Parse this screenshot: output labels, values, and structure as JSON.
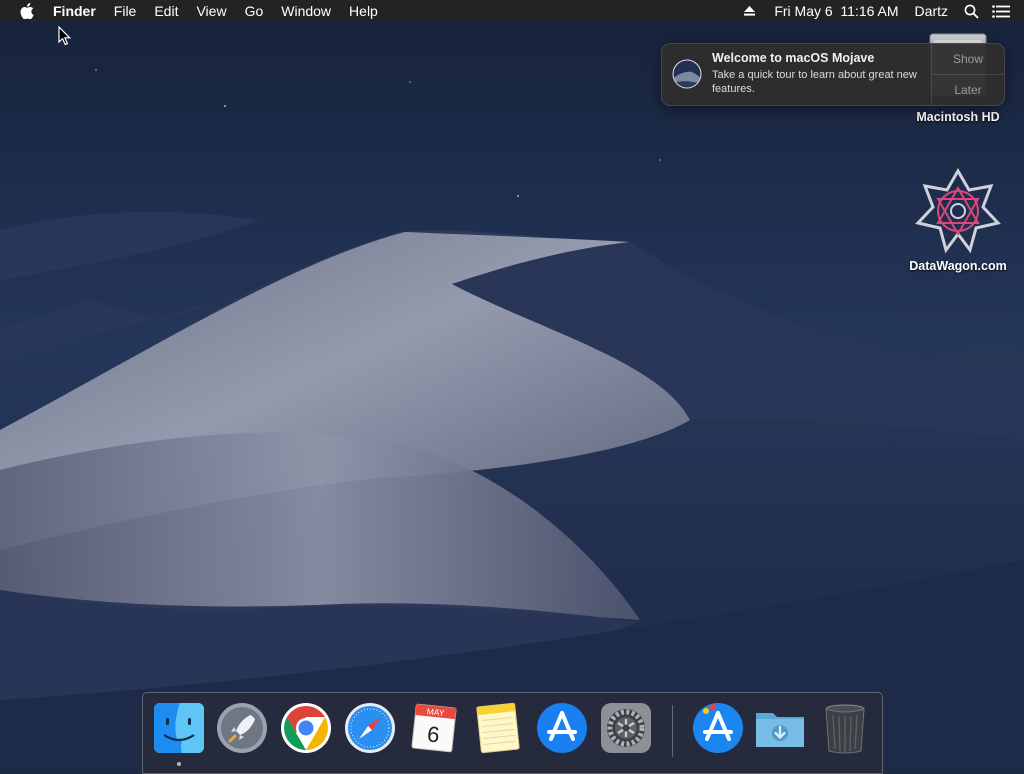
{
  "menubar": {
    "apple_icon": "apple-icon",
    "app_name": "Finder",
    "menus": [
      "File",
      "Edit",
      "View",
      "Go",
      "Window",
      "Help"
    ],
    "date_time": "Fri May 6  11:16 AM",
    "user": "Dartz",
    "icons": [
      "eject-icon",
      "spotlight-search-icon",
      "notification-center-icon"
    ]
  },
  "notification": {
    "title": "Welcome to macOS Mojave",
    "body": "Take a quick tour to learn about great new features.",
    "show_label": "Show",
    "later_label": "Later"
  },
  "desktop": {
    "items": [
      {
        "label": "Macintosh HD",
        "icon": "hard-drive-icon"
      },
      {
        "label": "DataWagon.com",
        "icon": "datawagon-logo-icon"
      }
    ]
  },
  "dock": {
    "apps": [
      {
        "name": "Finder",
        "icon": "finder-icon",
        "running": true
      },
      {
        "name": "Launchpad",
        "icon": "launchpad-icon"
      },
      {
        "name": "Google Chrome",
        "icon": "chrome-icon"
      },
      {
        "name": "Safari",
        "icon": "safari-icon"
      },
      {
        "name": "Calendar",
        "icon": "calendar-icon",
        "month": "MAY",
        "day": "6"
      },
      {
        "name": "Notes",
        "icon": "notes-icon"
      },
      {
        "name": "App Store",
        "icon": "app-store-icon"
      },
      {
        "name": "System Preferences",
        "icon": "system-preferences-icon"
      }
    ],
    "others": [
      {
        "name": "Applications",
        "icon": "applications-folder-icon"
      },
      {
        "name": "Downloads",
        "icon": "downloads-folder-icon"
      },
      {
        "name": "Trash",
        "icon": "trash-icon"
      }
    ]
  },
  "colors": {
    "menubar": "#232325",
    "sky": "#1c2a44",
    "dune": "#8d93a6",
    "notification_bg": "#2e2e30"
  }
}
